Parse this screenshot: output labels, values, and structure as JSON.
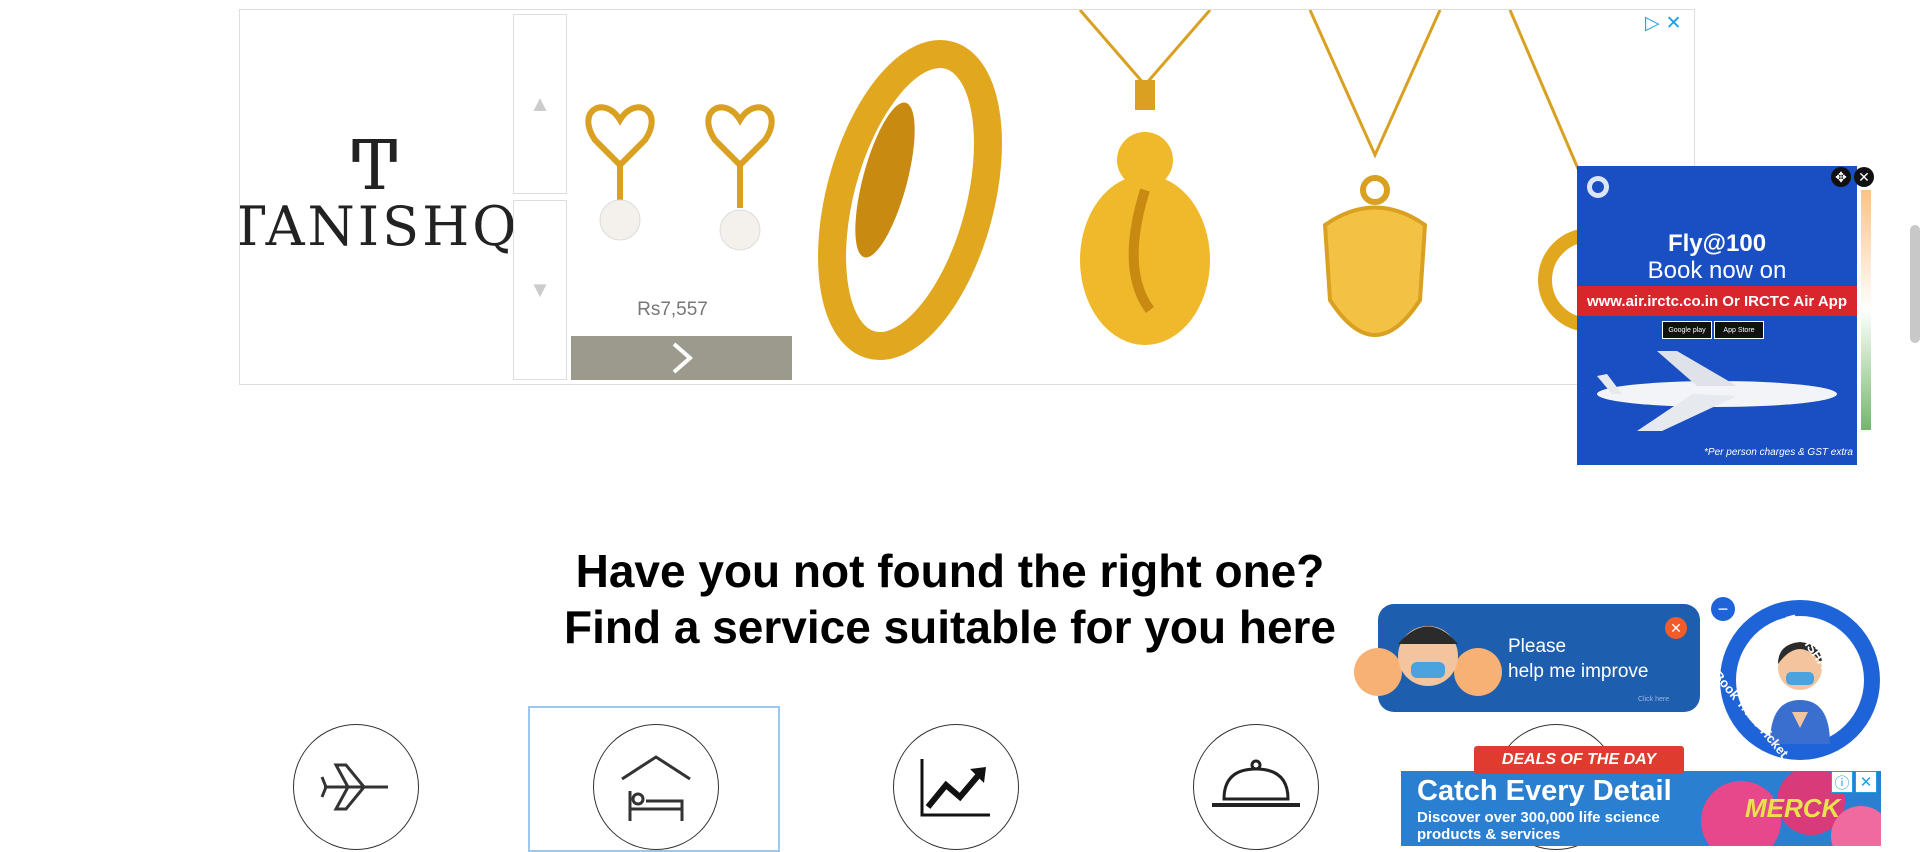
{
  "banner_ad": {
    "brand_mark": "Ͳ",
    "brand_word": "TANISHQ",
    "price": "Rs7,557",
    "scroll_up_icon": "up-triangle-icon",
    "scroll_down_icon": "down-triangle-icon",
    "next_icon": "chevron-right-icon",
    "adchoices_icon": "adchoices-icon",
    "close_icon": "close-icon",
    "products": [
      "pearl heart earrings",
      "gold ring",
      "ganesha pendant",
      "shield pendant",
      "heart pendant"
    ]
  },
  "fly_ad": {
    "title": "Fly@100",
    "subtitle": "Book now on",
    "url_text": "www.air.irctc.co.in Or IRCTC Air App",
    "store1": "Google play",
    "store2": "App Store",
    "note": "*Per person charges & GST extra"
  },
  "heading": {
    "line1": "Have you not found the right one?",
    "line2": "Find a service suitable for you here"
  },
  "services": [
    {
      "icon": "airplane-icon"
    },
    {
      "icon": "hotel-bed-icon"
    },
    {
      "icon": "trend-chart-icon"
    },
    {
      "icon": "food-cloche-icon"
    },
    {
      "icon": "more-service-icon"
    }
  ],
  "chat": {
    "line1": "Please",
    "line2": "help me improve",
    "hint": "Click here"
  },
  "disha": {
    "top_text": "AskDISHA 2.0",
    "bottom_text": "Book Train Ticket"
  },
  "merck_ad": {
    "ribbon": "DEALS OF THE DAY",
    "title": "Catch Every Detail",
    "sub": "Discover over 300,000 life science products & services",
    "logo": "MERCK"
  }
}
